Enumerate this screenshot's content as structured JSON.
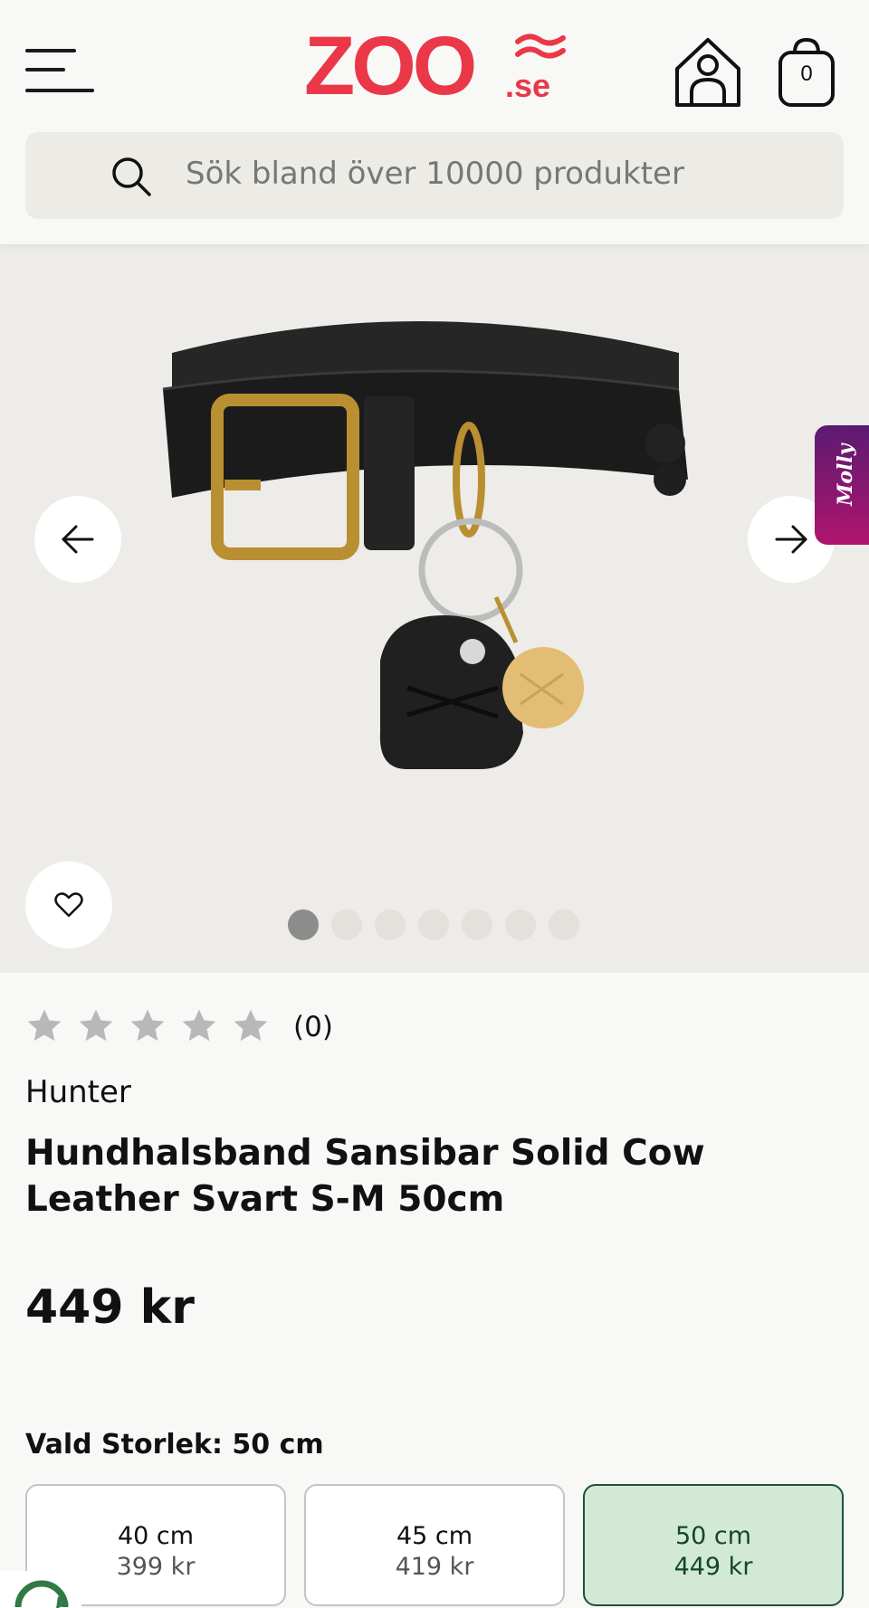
{
  "header": {
    "logo_main": "ZOO",
    "logo_suffix": ".se",
    "cart_count": "0",
    "search_placeholder": "Sök bland över 10000 produkter"
  },
  "gallery": {
    "chat_widget_label": "Molly",
    "image_count": 7,
    "active_image": 1
  },
  "product": {
    "rating": {
      "stars_filled": 0,
      "stars_total": 5,
      "count_label": "(0)"
    },
    "brand": "Hunter",
    "title": "Hundhalsband Sansibar Solid Cow Leather Svart S-M 50cm",
    "price": "449 kr",
    "selected_size_label": "Vald Storlek: 50 cm",
    "sizes": [
      {
        "size": "40 cm",
        "price": "399 kr",
        "selected": false
      },
      {
        "size": "45 cm",
        "price": "419 kr",
        "selected": false
      },
      {
        "size": "50 cm",
        "price": "449 kr",
        "selected": true
      }
    ]
  },
  "colors": {
    "brand_red": "#ea3848",
    "selected_bg": "#d2ead5",
    "selected_border": "#20503a",
    "molly_gradient": [
      "#5b1a72",
      "#b0156d"
    ]
  },
  "icons": [
    "menu-icon",
    "home-icon",
    "cart-icon",
    "search-icon",
    "arrow-left-icon",
    "arrow-right-icon",
    "heart-icon",
    "star-icon",
    "recycle-badge-icon"
  ]
}
